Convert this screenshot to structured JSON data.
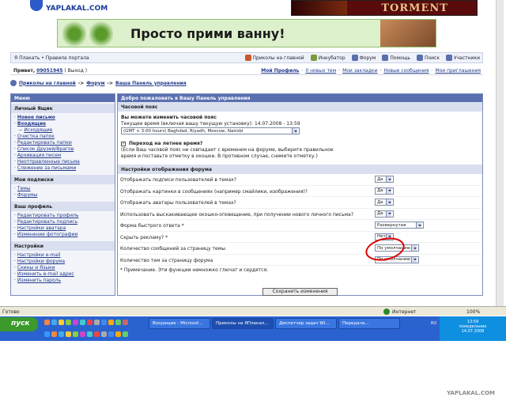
{
  "banners": {
    "logo_text": "YAPLAKAL.COM",
    "torment_text": "TORMENT",
    "ad_text": "Просто прими ванну!"
  },
  "nav": {
    "crumb": "Я Плакать • Правила портала",
    "items": [
      {
        "label": "Приколы на главной",
        "color": "#c85a2a"
      },
      {
        "label": "Инкубатор",
        "color": "#7a9a3a"
      },
      {
        "label": "Форум",
        "color": "#5a6fb0"
      },
      {
        "label": "Помощь",
        "color": "#5a6fb0"
      },
      {
        "label": "Поиск",
        "color": "#5a6fb0"
      },
      {
        "label": "Участники",
        "color": "#5a6fb0"
      }
    ]
  },
  "userbar": {
    "hello": "Привет,",
    "username": "09051945",
    "logout": "( Выход )",
    "profile": "Мой Профиль",
    "links": [
      "0 новых тем",
      "Мои закладки",
      "Новые сообщения",
      "Мои приглашения"
    ]
  },
  "breadcrumb": [
    "Приколы на главной",
    "Форум",
    "Ваша Панель управления"
  ],
  "sidebar": {
    "title": "Меню",
    "sections": [
      {
        "title": "Личный Ящик",
        "items": [
          {
            "label": "Новое письмо",
            "sub": false,
            "bold": true
          },
          {
            "label": "Входящие",
            "sub": false,
            "bold": true
          },
          {
            "label": "Исходящие",
            "sub": true,
            "bold": false
          },
          {
            "label": "Очистка папок",
            "sub": false,
            "bold": false
          },
          {
            "label": "Редактировать папки",
            "sub": false,
            "bold": false
          },
          {
            "label": "Список Друзей/Врагов",
            "sub": false,
            "bold": false
          },
          {
            "label": "Архивация писем",
            "sub": false,
            "bold": false
          },
          {
            "label": "Неотправленные письма",
            "sub": false,
            "bold": false
          },
          {
            "label": "Слежение за письмами",
            "sub": false,
            "bold": false
          }
        ]
      },
      {
        "title": "Мои подписки",
        "items": [
          {
            "label": "Темы",
            "sub": false,
            "bold": false
          },
          {
            "label": "Форумы",
            "sub": false,
            "bold": false
          }
        ]
      },
      {
        "title": "Ваш профиль",
        "items": [
          {
            "label": "Редактировать профиль",
            "sub": false,
            "bold": false
          },
          {
            "label": "Редактировать подпись",
            "sub": false,
            "bold": false
          },
          {
            "label": "Настройки аватара",
            "sub": false,
            "bold": false
          },
          {
            "label": "Изменение фотографии",
            "sub": false,
            "bold": false
          }
        ]
      },
      {
        "title": "Настройки",
        "items": [
          {
            "label": "Настройки e-mail",
            "sub": false,
            "bold": false
          },
          {
            "label": "Настройки форума",
            "sub": false,
            "bold": false
          },
          {
            "label": "Скины и Языки",
            "sub": false,
            "bold": false
          },
          {
            "label": "Изменить e-mail адрес",
            "sub": false,
            "bold": false
          },
          {
            "label": "Изменить пароль",
            "sub": false,
            "bold": false
          }
        ]
      }
    ]
  },
  "main": {
    "title": "Добро пожаловать в Вашу Панель управления",
    "tz_section": "Часовой пояс",
    "tz_heading": "Вы можете изменить часовой пояс",
    "tz_current": "Текущее время (включая вашу текущую установку): 14.07.2008 - 13:59",
    "tz_value": "(GMT + 3:00 hours) Baghdad, Riyadh, Moscow, Nairobi",
    "dst_label": "Переход на летнее время?",
    "dst_note1": "(Если Ваш часовой пояс не совпадает с временем на форуме, выберите правильное",
    "dst_note2": "время и поставьте отметку в окошке. В противном случае, снимите отметку.)",
    "display_section": "Настройки отображения форума",
    "rows": [
      {
        "label": "Отображать подписи пользователей в темах?",
        "value": "Да"
      },
      {
        "label": "Отображать картинки в сообщениях (например смайлики, изображения)?",
        "value": "Да"
      },
      {
        "label": "Отображать аватары пользователей в темах?",
        "value": "Да"
      },
      {
        "label": "Использовать выскакивающее окошко-оповещение, при получении нового личного письма?",
        "value": "Да"
      },
      {
        "label": "Форма быстрого ответа *",
        "value": "Развернутая"
      },
      {
        "label": "Скрыть рекламу? *",
        "value": "Нет"
      },
      {
        "label": "Количество сообщений за страницу темы",
        "value": "По умолчанию"
      },
      {
        "label": "Количество тем за страницу форума",
        "value": "По умолчанию"
      }
    ],
    "footnote": "* Примечание. Эти функции немножко глючат и сердятся.",
    "save_label": "Сохранить изменения"
  },
  "statusbar": {
    "left": "Готово",
    "zoom": "100%",
    "zone": "Интернет"
  },
  "taskbar": {
    "start": "пуск",
    "windows": [
      "Входящие - Microsof...",
      "Приколы на ЯПлакал...",
      "Диспетчер задач Wi...",
      "Передача..."
    ],
    "lang": "RU",
    "clock": "13:59",
    "day": "понедельник",
    "date": "14.07.2008"
  },
  "watermark": "YAPLAKAL.COM"
}
